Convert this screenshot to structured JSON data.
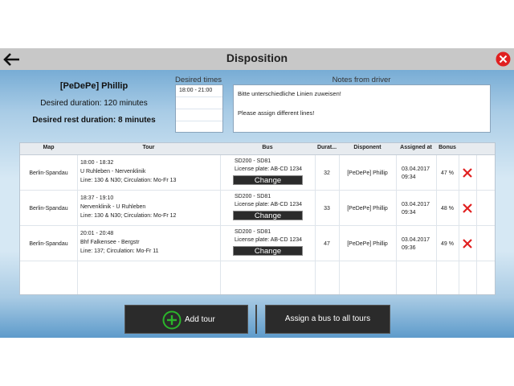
{
  "window": {
    "title": "Disposition"
  },
  "driver": {
    "name": "[PeDePe] Phillip",
    "desired_duration": "Desired duration: 120 minutes",
    "rest_duration": "Desired rest duration: 8 minutes"
  },
  "desired_times": {
    "label": "Desired times",
    "items": [
      "18:00 - 21:00",
      "",
      "",
      ""
    ]
  },
  "notes": {
    "label": "Notes from driver",
    "line1": "Bitte unterschiedliche Linien zuweisen!",
    "line2": "Please assign different lines!"
  },
  "table": {
    "columns": [
      "Map",
      "Tour",
      "Bus",
      "Durat...",
      "Disponent",
      "Assigned at",
      "Bonus"
    ],
    "rows": [
      {
        "map": "Berlin-Spandau",
        "tour_time": "18:00 - 18:32",
        "tour_route": "U Ruhleben - Nervenklinik",
        "tour_line": "Line: 130 & N30; Circulation: Mo-Fr 13",
        "bus_model": "SD200 - SD81",
        "bus_plate": "License plate: AB-CD 1234",
        "change_label": "Change",
        "duration": "32",
        "disponent": "[PeDePe] Phillip",
        "assigned_date": "03.04.2017",
        "assigned_time": "09:34",
        "bonus": "47 %"
      },
      {
        "map": "Berlin-Spandau",
        "tour_time": "18:37 - 19:10",
        "tour_route": "Nervenklinik - U Ruhleben",
        "tour_line": "Line: 130 & N30; Circulation: Mo-Fr 12",
        "bus_model": "SD200 - SD81",
        "bus_plate": "License plate: AB-CD 1234",
        "change_label": "Change",
        "duration": "33",
        "disponent": "[PeDePe] Phillip",
        "assigned_date": "03.04.2017",
        "assigned_time": "09:34",
        "bonus": "48 %"
      },
      {
        "map": "Berlin-Spandau",
        "tour_time": "20:01 - 20:48",
        "tour_route": "Bhf Falkensee - Bergstr",
        "tour_line": "Line: 137; Circulation: Mo-Fr 11",
        "bus_model": "SD200 - SD81",
        "bus_plate": "License plate: AB-CD 1234",
        "change_label": "Change",
        "duration": "47",
        "disponent": "[PeDePe] Phillip",
        "assigned_date": "03.04.2017",
        "assigned_time": "09:36",
        "bonus": "49 %"
      }
    ]
  },
  "actions": {
    "add_tour": "Add tour",
    "assign_all": "Assign a bus to all tours"
  },
  "icons": {
    "back": "arrow-left-icon",
    "close": "close-circle-icon",
    "add": "plus-circle-icon",
    "delete": "x-icon"
  },
  "colors": {
    "titlebar": "#c8c8c8",
    "close_red": "#e02020",
    "delete_red": "#e02020",
    "add_green": "#2bb52b",
    "button_dark": "#2b2b2b"
  }
}
